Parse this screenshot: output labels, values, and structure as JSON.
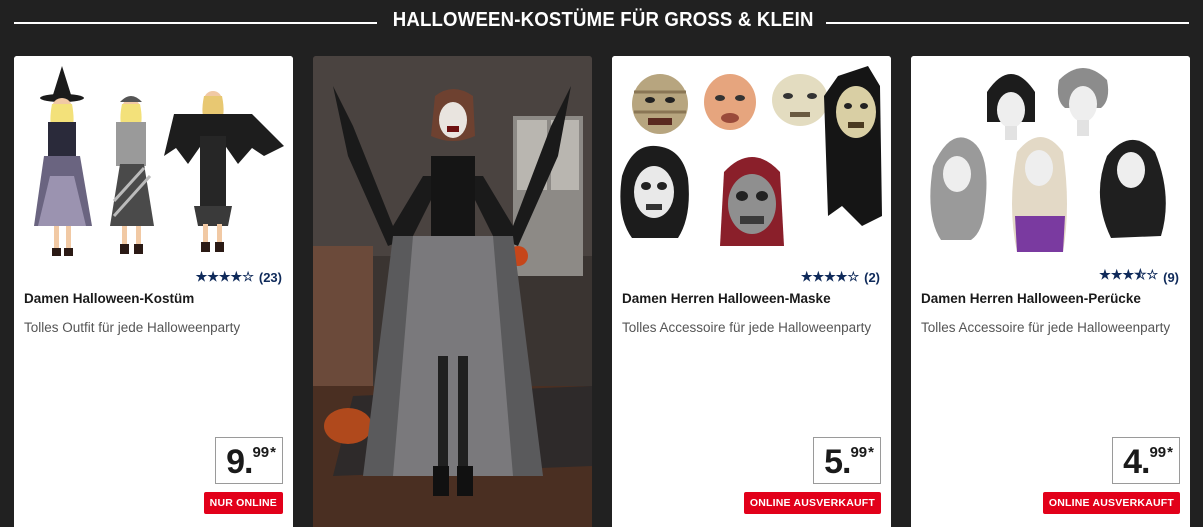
{
  "section": {
    "title": "HALLOWEEN-KOSTÜME FÜR GROSS & KLEIN"
  },
  "colors": {
    "background": "#212121",
    "badge": "#e2001a",
    "star": "#0f2a5a"
  },
  "products": [
    {
      "name": "Damen Halloween-Kostüm",
      "description": "Tolles Outfit für jede Halloweenparty",
      "rating": 4,
      "rating_stars": "★★★★☆",
      "reviews": "(23)",
      "price_main": "9.",
      "price_cents": "99",
      "price_suffix": "*",
      "badge": "NUR ONLINE",
      "image_icon": "witch-costume-image"
    },
    {
      "image_icon": "vampire-costume-model-image"
    },
    {
      "name": "Damen Herren Halloween-Maske",
      "description": "Tolles Accessoire für jede Halloweenparty",
      "rating": 4,
      "rating_stars": "★★★★☆",
      "reviews": "(2)",
      "price_main": "5.",
      "price_cents": "99",
      "price_suffix": "*",
      "badge": "ONLINE AUSVERKAUFT",
      "image_icon": "halloween-masks-image"
    },
    {
      "name": "Damen Herren Halloween-Perücke",
      "description": "Tolles Accessoire für jede Halloweenparty",
      "rating": 3.5,
      "rating_stars": "★★★⯪☆",
      "reviews": "(9)",
      "price_main": "4.",
      "price_cents": "99",
      "price_suffix": "*",
      "badge": "ONLINE AUSVERKAUFT",
      "image_icon": "halloween-wigs-image"
    }
  ]
}
